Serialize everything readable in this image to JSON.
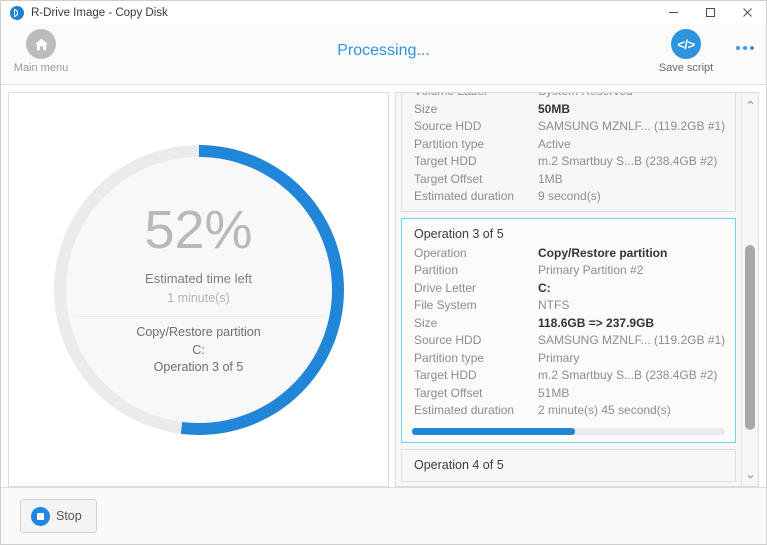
{
  "window": {
    "title": "R-Drive Image - Copy Disk",
    "logo_icon": "r-drive-logo-icon",
    "controls": {
      "minimize": "minimize-icon",
      "maximize": "maximize-icon",
      "close": "close-icon"
    }
  },
  "toolbar": {
    "main_menu_label": "Main menu",
    "main_menu_icon": "home-icon",
    "status_title": "Processing...",
    "save_script_label": "Save script",
    "save_script_icon": "code-brackets-icon",
    "overflow_icon": "more-dots-icon"
  },
  "progress": {
    "percent_text": "52%",
    "percent_value": 52,
    "eta_label": "Estimated time left",
    "eta_value": "1 minute(s)",
    "operation_name": "Copy/Restore partition",
    "operation_drive": "C:",
    "operation_counter": "Operation 3 of 5",
    "ring_color": "#2186d8",
    "ring_track_color": "#ebebeb"
  },
  "operations": [
    {
      "title": "",
      "clipped": true,
      "active": false,
      "rows": [
        {
          "label": "Volume Label",
          "value": "System Reserved",
          "bold": false
        },
        {
          "label": "Size",
          "value": "50MB",
          "bold": true
        },
        {
          "label": "Source HDD",
          "value": "SAMSUNG MZNLF... (119.2GB #1)",
          "bold": false
        },
        {
          "label": "Partition type",
          "value": "Active",
          "bold": false
        },
        {
          "label": "Target HDD",
          "value": "m.2 Smartbuy S...B (238.4GB #2)",
          "bold": false
        },
        {
          "label": "Target Offset",
          "value": "1MB",
          "bold": false
        },
        {
          "label": "Estimated duration",
          "value": "9 second(s)",
          "bold": false
        }
      ]
    },
    {
      "title": "Operation 3 of 5",
      "clipped": false,
      "active": true,
      "progress_percent": 52,
      "rows": [
        {
          "label": "Operation",
          "value": "Copy/Restore partition",
          "bold": true
        },
        {
          "label": "Partition",
          "value": "Primary Partition #2",
          "bold": false
        },
        {
          "label": "Drive Letter",
          "value": "C:",
          "bold": true
        },
        {
          "label": "File System",
          "value": "NTFS",
          "bold": false
        },
        {
          "label": "Size",
          "value": "118.6GB => 237.9GB",
          "bold": true
        },
        {
          "label": "Source HDD",
          "value": "SAMSUNG MZNLF... (119.2GB #1)",
          "bold": false
        },
        {
          "label": "Partition type",
          "value": "Primary",
          "bold": false
        },
        {
          "label": "Target HDD",
          "value": "m.2 Smartbuy S...B (238.4GB #2)",
          "bold": false
        },
        {
          "label": "Target Offset",
          "value": "51MB",
          "bold": false
        },
        {
          "label": "Estimated duration",
          "value": "2 minute(s) 45 second(s)",
          "bold": false
        }
      ]
    },
    {
      "title": "Operation 4 of 5",
      "clipped": false,
      "active": false,
      "rows": []
    }
  ],
  "scrollbar": {
    "up_icon": "chevron-up-icon",
    "down_icon": "chevron-down-icon"
  },
  "footer": {
    "stop_label": "Stop",
    "stop_icon": "stop-icon"
  }
}
